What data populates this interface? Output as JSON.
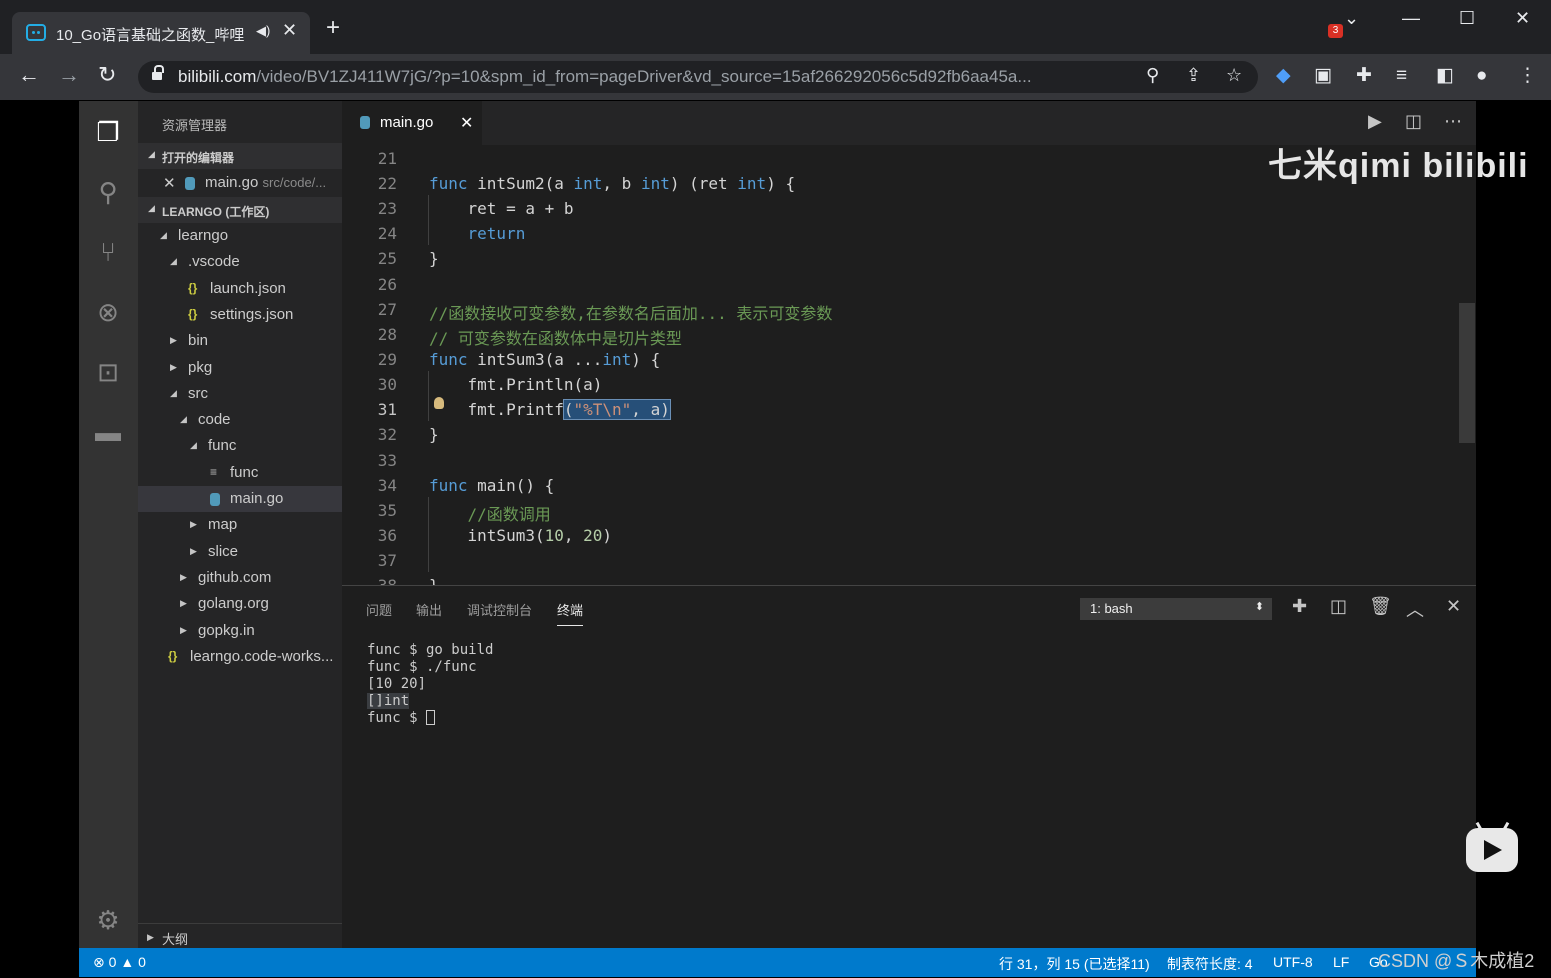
{
  "browser": {
    "tab_title": "10_Go语言基础之函数_哔哩",
    "url_host": "bilibili.com",
    "url_path": "/video/BV1ZJ411W7jG/?p=10&spm_id_from=pageDriver&vd_source=15af266292056c5d92fb6aa45a...",
    "ext_badge": "3"
  },
  "vscode": {
    "sidebar": {
      "title": "资源管理器",
      "open_editors_label": "打开的编辑器",
      "open_editor_file": "main.go",
      "open_editor_path": "src/code/...",
      "workspace_label": "LEARNGO (工作区)",
      "tree": [
        {
          "label": "learngo",
          "type": "folder-open"
        },
        {
          "label": ".vscode",
          "type": "folder-open"
        },
        {
          "label": "launch.json",
          "type": "json"
        },
        {
          "label": "settings.json",
          "type": "json"
        },
        {
          "label": "bin",
          "type": "folder"
        },
        {
          "label": "pkg",
          "type": "folder"
        },
        {
          "label": "src",
          "type": "folder-open"
        },
        {
          "label": "code",
          "type": "folder-open"
        },
        {
          "label": "func",
          "type": "folder-open"
        },
        {
          "label": "func",
          "type": "file"
        },
        {
          "label": "main.go",
          "type": "go"
        },
        {
          "label": "map",
          "type": "folder"
        },
        {
          "label": "slice",
          "type": "folder"
        },
        {
          "label": "github.com",
          "type": "folder"
        },
        {
          "label": "golang.org",
          "type": "folder"
        },
        {
          "label": "gopkg.in",
          "type": "folder"
        },
        {
          "label": "learngo.code-works...",
          "type": "json"
        }
      ],
      "outline_label": "大纲"
    },
    "editor": {
      "tab_label": "main.go",
      "line_numbers": [
        "21",
        "22",
        "23",
        "24",
        "25",
        "26",
        "27",
        "28",
        "29",
        "30",
        "31",
        "32",
        "33",
        "34",
        "35",
        "36",
        "37",
        "38"
      ]
    },
    "panel": {
      "tabs": [
        "问题",
        "输出",
        "调试控制台",
        "终端"
      ],
      "terminal_select": "1: bash",
      "terminal_lines": [
        "func $ go build",
        "func $ ./func",
        "[10 20]",
        "[]int",
        "func $ "
      ]
    },
    "statusbar": {
      "errors": "0",
      "warnings": "0",
      "position": "行 31，列 15 (已选择11)",
      "tab_size": "制表符长度: 4",
      "encoding": "UTF-8",
      "eol": "LF",
      "lang": "Go"
    }
  },
  "overlay": {
    "watermark": "七米qimi bilibili",
    "csdn": "CSDN @Ｓ木成植2"
  }
}
